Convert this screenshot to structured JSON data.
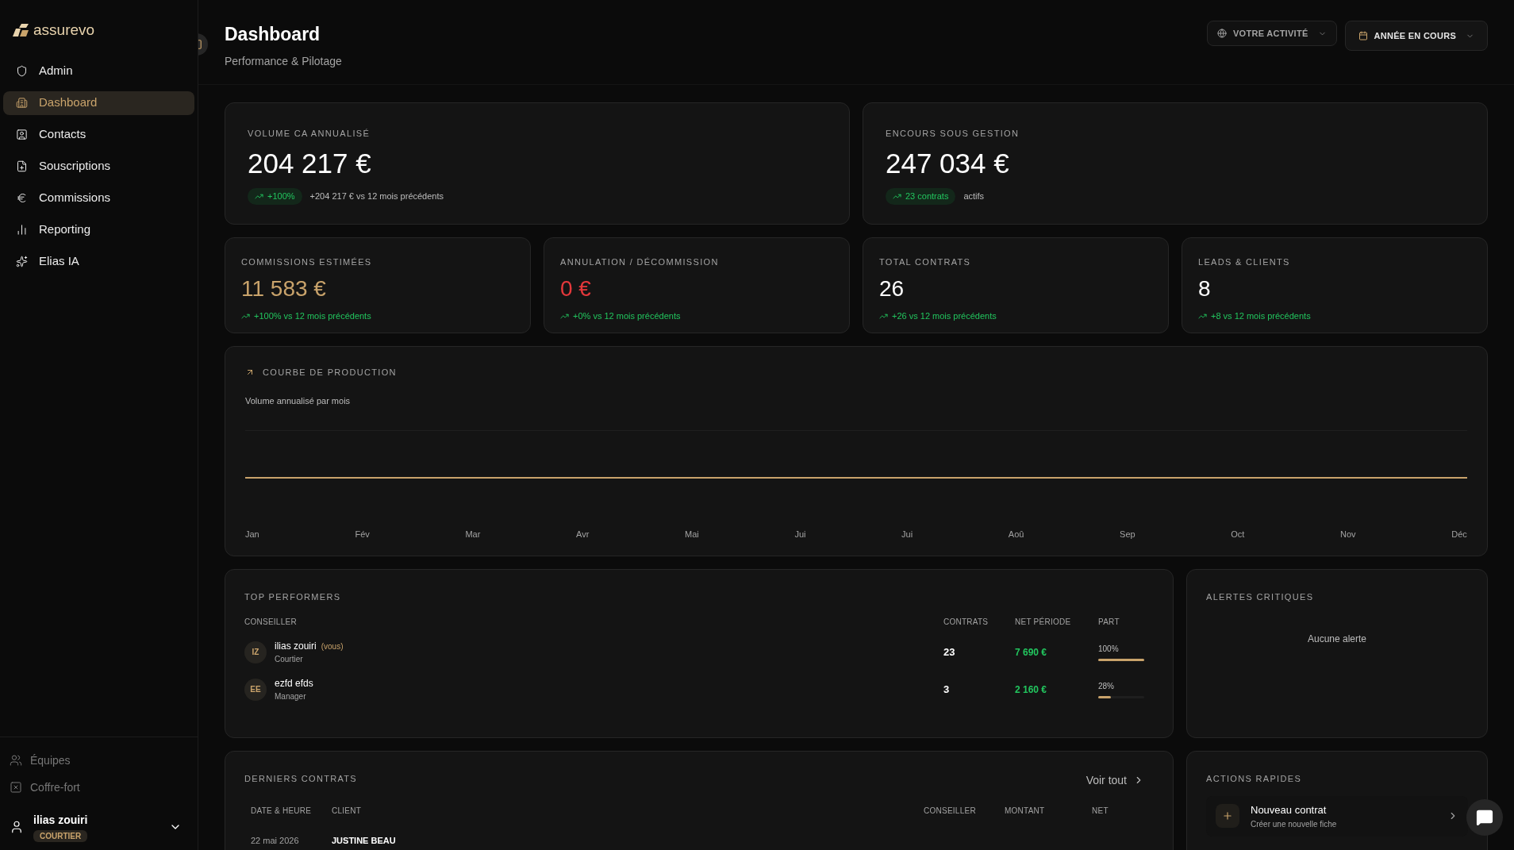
{
  "brand": "assurevo",
  "sidebar": {
    "items": [
      {
        "kind": "admin",
        "label": "Admin",
        "selected": false
      },
      {
        "kind": "dashboard",
        "label": "Dashboard",
        "selected": true
      },
      {
        "kind": "contacts",
        "label": "Contacts",
        "selected": false
      },
      {
        "kind": "subscriptions",
        "label": "Souscriptions",
        "selected": false
      },
      {
        "kind": "commissions",
        "label": "Commissions",
        "selected": false
      },
      {
        "kind": "reporting",
        "label": "Reporting",
        "selected": false
      },
      {
        "kind": "ai",
        "label": "Elias IA",
        "selected": false
      }
    ],
    "footer_items": [
      {
        "kind": "teams",
        "label": "Équipes"
      },
      {
        "kind": "vault",
        "label": "Coffre-fort"
      }
    ],
    "user": {
      "name": "ilias zouiri",
      "role": "COURTIER"
    }
  },
  "header": {
    "title": "Dashboard",
    "subtitle": "Performance & Pilotage",
    "filters": [
      {
        "kind": "globe",
        "label": "VOTRE ACTIVITÉ",
        "selected": false
      },
      {
        "kind": "calendar",
        "label": "ANNÉE EN COURS",
        "selected": true
      }
    ]
  },
  "hero_cards": [
    {
      "label": "VOLUME CA ANNUALISÉ",
      "value": "204 217 €",
      "badge": "+100%",
      "note": "+204 217 € vs 12 mois précédents"
    },
    {
      "label": "ENCOURS SOUS GESTION",
      "value": "247 034 €",
      "badge": "23 contrats",
      "note": "actifs"
    }
  ],
  "kpis": [
    {
      "label": "COMMISSIONS ESTIMÉES",
      "value": "11 583 €",
      "color": "#c9a36b",
      "trend": "+100% vs 12 mois précédents"
    },
    {
      "label": "ANNULATION / DÉCOMMISSION",
      "value": "0 €",
      "color": "#e5383b",
      "trend": "+0% vs 12 mois précédents"
    },
    {
      "label": "TOTAL CONTRATS",
      "value": "26",
      "color": "#ffffff",
      "trend": "+26 vs 12 mois précédents"
    },
    {
      "label": "LEADS & CLIENTS",
      "value": "8",
      "color": "#ffffff",
      "trend": "+8 vs 12 mois précédents"
    }
  ],
  "production_chart": {
    "title": "COURBE DE PRODUCTION",
    "subtitle": "Volume annualisé par mois",
    "months": [
      "Jan",
      "Fév",
      "Mar",
      "Avr",
      "Mai",
      "Jui",
      "Jui",
      "Aoû",
      "Sep",
      "Oct",
      "Nov",
      "Déc"
    ]
  },
  "top_performers": {
    "title": "TOP PERFORMERS",
    "columns": [
      "CONSEILLER",
      "CONTRATS",
      "NET PÉRIODE",
      "PART"
    ],
    "rows": [
      {
        "initials": "IZ",
        "name": "ilias zouiri",
        "tag": "(vous)",
        "role": "Courtier",
        "contracts": "23",
        "net": "7 690 €",
        "share": "100%",
        "level": 1
      },
      {
        "initials": "EE",
        "name": "ezfd efds",
        "role": "Manager",
        "contracts": "3",
        "net": "2 160 €",
        "share": "28%",
        "level": 0.28
      }
    ]
  },
  "alerts": {
    "title": "ALERTES CRITIQUES",
    "empty": "Aucune alerte"
  },
  "recent_contracts": {
    "title": "DERNIERS CONTRATS",
    "link": "Voir tout",
    "columns": [
      "DATE & HEURE",
      "CLIENT",
      "CONSEILLER",
      "MONTANT",
      "NET"
    ],
    "rows": [
      {
        "date": "22 mai 2026",
        "client": "JUSTINE BEAU"
      }
    ]
  },
  "quick_actions": {
    "title": "ACTIONS RAPIDES",
    "items": [
      {
        "title": "Nouveau contrat",
        "subtitle": "Créer une nouvelle fiche"
      }
    ]
  }
}
